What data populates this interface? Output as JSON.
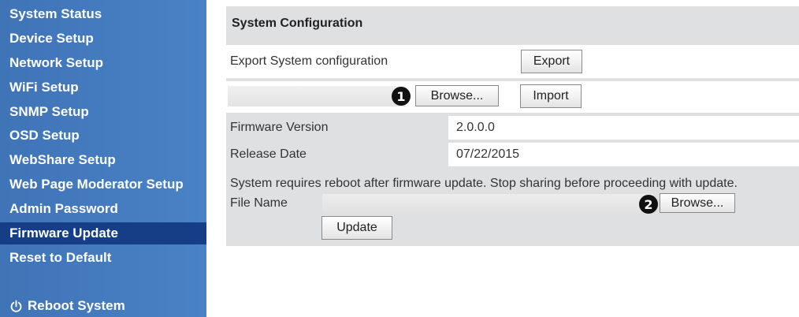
{
  "sidebar": {
    "items": [
      {
        "label": "System Status"
      },
      {
        "label": "Device Setup"
      },
      {
        "label": "Network Setup"
      },
      {
        "label": "WiFi Setup"
      },
      {
        "label": "SNMP Setup"
      },
      {
        "label": "OSD Setup"
      },
      {
        "label": "WebShare Setup"
      },
      {
        "label": "Web Page Moderator Setup"
      },
      {
        "label": "Admin Password"
      },
      {
        "label": "Firmware Update"
      },
      {
        "label": "Reset to Default"
      }
    ],
    "active_item": "Firmware Update",
    "reboot": {
      "label": "Reboot System",
      "icon": "power-icon"
    }
  },
  "panel": {
    "title": "System Configuration",
    "export_label": "Export System configuration",
    "export_button": "Export",
    "browse_button": "Browse...",
    "import_button": "Import",
    "marker1": "1",
    "firmware_version_label": "Firmware Version",
    "firmware_version_value": "2.0.0.0",
    "release_date_label": "Release Date",
    "release_date_value": "07/22/2015",
    "reboot_notice": "System requires reboot after firmware update. Stop sharing before proceeding with update.",
    "file_name_label": "File Name",
    "browse_button_2": "Browse...",
    "marker2": "2",
    "update_button": "Update"
  },
  "colors": {
    "sidebar": "#4279bd",
    "active_item": "#153e86",
    "panel": "#dfe0e2"
  }
}
